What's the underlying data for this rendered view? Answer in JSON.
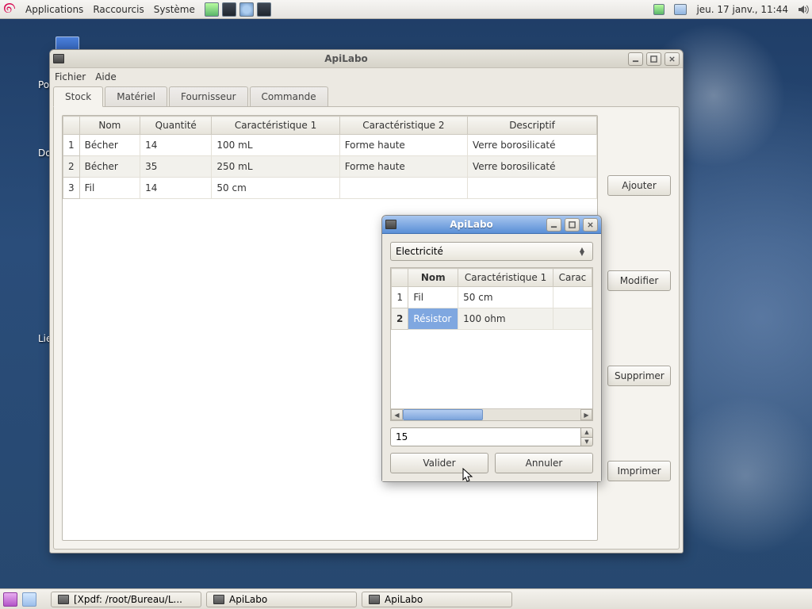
{
  "panel": {
    "menus": [
      "Applications",
      "Raccourcis",
      "Système"
    ],
    "clock": "jeu. 17 janv., 11:44"
  },
  "desktop": {
    "label1": "Pos",
    "label2": "Doss",
    "label3": "Lien ve"
  },
  "mainWindow": {
    "title": "ApiLabo",
    "menu": {
      "file": "Fichier",
      "help": "Aide"
    },
    "tabs": {
      "stock": "Stock",
      "materiel": "Matériel",
      "fournisseur": "Fournisseur",
      "commande": "Commande"
    },
    "table": {
      "headers": {
        "nom": "Nom",
        "quantite": "Quantité",
        "c1": "Caractéristique 1",
        "c2": "Caractéristique 2",
        "desc": "Descriptif"
      },
      "rows": [
        {
          "idx": "1",
          "nom": "Bécher",
          "qte": "14",
          "c1": "100 mL",
          "c2": "Forme haute",
          "desc": "Verre borosilicaté"
        },
        {
          "idx": "2",
          "nom": "Bécher",
          "qte": "35",
          "c1": "250 mL",
          "c2": "Forme haute",
          "desc": "Verre borosilicaté"
        },
        {
          "idx": "3",
          "nom": "Fil",
          "qte": "14",
          "c1": "50 cm",
          "c2": "",
          "desc": ""
        }
      ]
    },
    "buttons": {
      "add": "Ajouter",
      "edit": "Modifier",
      "del": "Supprimer",
      "print": "Imprimer"
    }
  },
  "dialog": {
    "title": "ApiLabo",
    "combo": "Electricité",
    "table": {
      "headers": {
        "nom": "Nom",
        "c1": "Caractéristique 1",
        "c2": "Carac"
      },
      "rows": [
        {
          "idx": "1",
          "nom": "Fil",
          "c1": "50 cm"
        },
        {
          "idx": "2",
          "nom": "Résistor",
          "c1": "100 ohm"
        }
      ]
    },
    "spinner_value": "15",
    "ok": "Valider",
    "cancel": "Annuler"
  },
  "taskbar": {
    "items": [
      "[Xpdf: /root/Bureau/L...",
      "ApiLabo",
      "ApiLabo"
    ]
  }
}
